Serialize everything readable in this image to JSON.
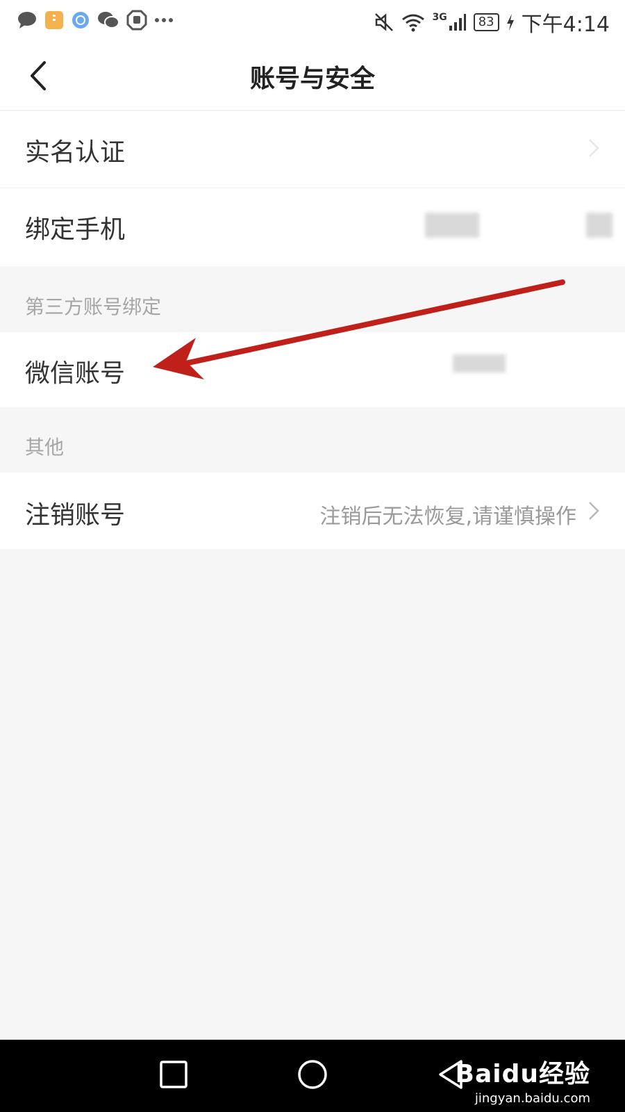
{
  "status": {
    "time": "下午4:14",
    "battery": "83",
    "network": "3G"
  },
  "header": {
    "title": "账号与安全"
  },
  "rows": {
    "real_name": "实名认证",
    "bind_phone": "绑定手机",
    "wechat": "微信账号",
    "cancel": "注销账号",
    "cancel_hint": "注销后无法恢复,请谨慎操作"
  },
  "sections": {
    "third_party": "第三方账号绑定",
    "other": "其他"
  },
  "watermark": {
    "brand": "Baidu经验",
    "url": "jingyan.baidu.com"
  },
  "icons": {
    "status_left": [
      "message-icon",
      "note-icon",
      "browser-icon",
      "wechat-icon",
      "hand-icon",
      "more-icon"
    ],
    "status_right": [
      "mute-icon",
      "wifi-icon",
      "signal-icon",
      "battery-icon",
      "charging-icon"
    ],
    "nav": [
      "recent-apps-icon",
      "home-icon",
      "back-icon"
    ]
  },
  "colors": {
    "annotation_arrow": "#c0201a",
    "background": "#f6f6f6",
    "section_text": "#a6a6a6"
  }
}
